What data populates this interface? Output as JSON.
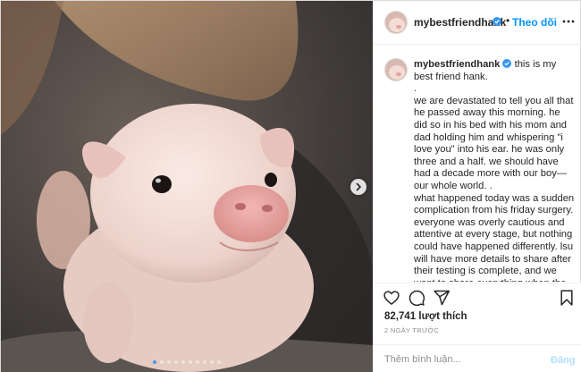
{
  "post": {
    "username": "mybestfriendhank",
    "follow_separator": "•",
    "follow_label": "Theo dõi",
    "caption_body": "this is my best friend hank.\n.\nwe are devastated to tell you all that he passed away this morning. he did so in his bed with his mom and dad holding him and whispering \"i love you\" into his ear. he was only three and a half. we should have had a decade more with our boy—our whole world. .\nwhat happened today was a sudden complication from his friday surgery. everyone was overly cautious and attentive at every stage, but nothing could have happened differently. lsu will have more details to share after their testing is complete, and we want to share everything when the time is right. for today, we'd like to focus on",
    "likes_label": "82,741 lượt thích",
    "time_label": "2 NGÀY TRƯỚC",
    "comment_placeholder": "Thêm bình luận...",
    "post_button_label": "Đăng"
  },
  "carousel": {
    "slide_count": 10,
    "active_index": 0
  },
  "icons": {
    "verified": "verified-badge-icon",
    "more": "more-options-icon",
    "like": "heart-icon",
    "comment": "comment-icon",
    "share": "share-icon",
    "save": "bookmark-icon",
    "next": "chevron-right-icon"
  },
  "colors": {
    "accent": "#0095f6",
    "verified": "#3897f0",
    "post_button_disabled": "#b2dffc",
    "muted_text": "#8e8e8e",
    "active_dot": "#3d97f0"
  }
}
